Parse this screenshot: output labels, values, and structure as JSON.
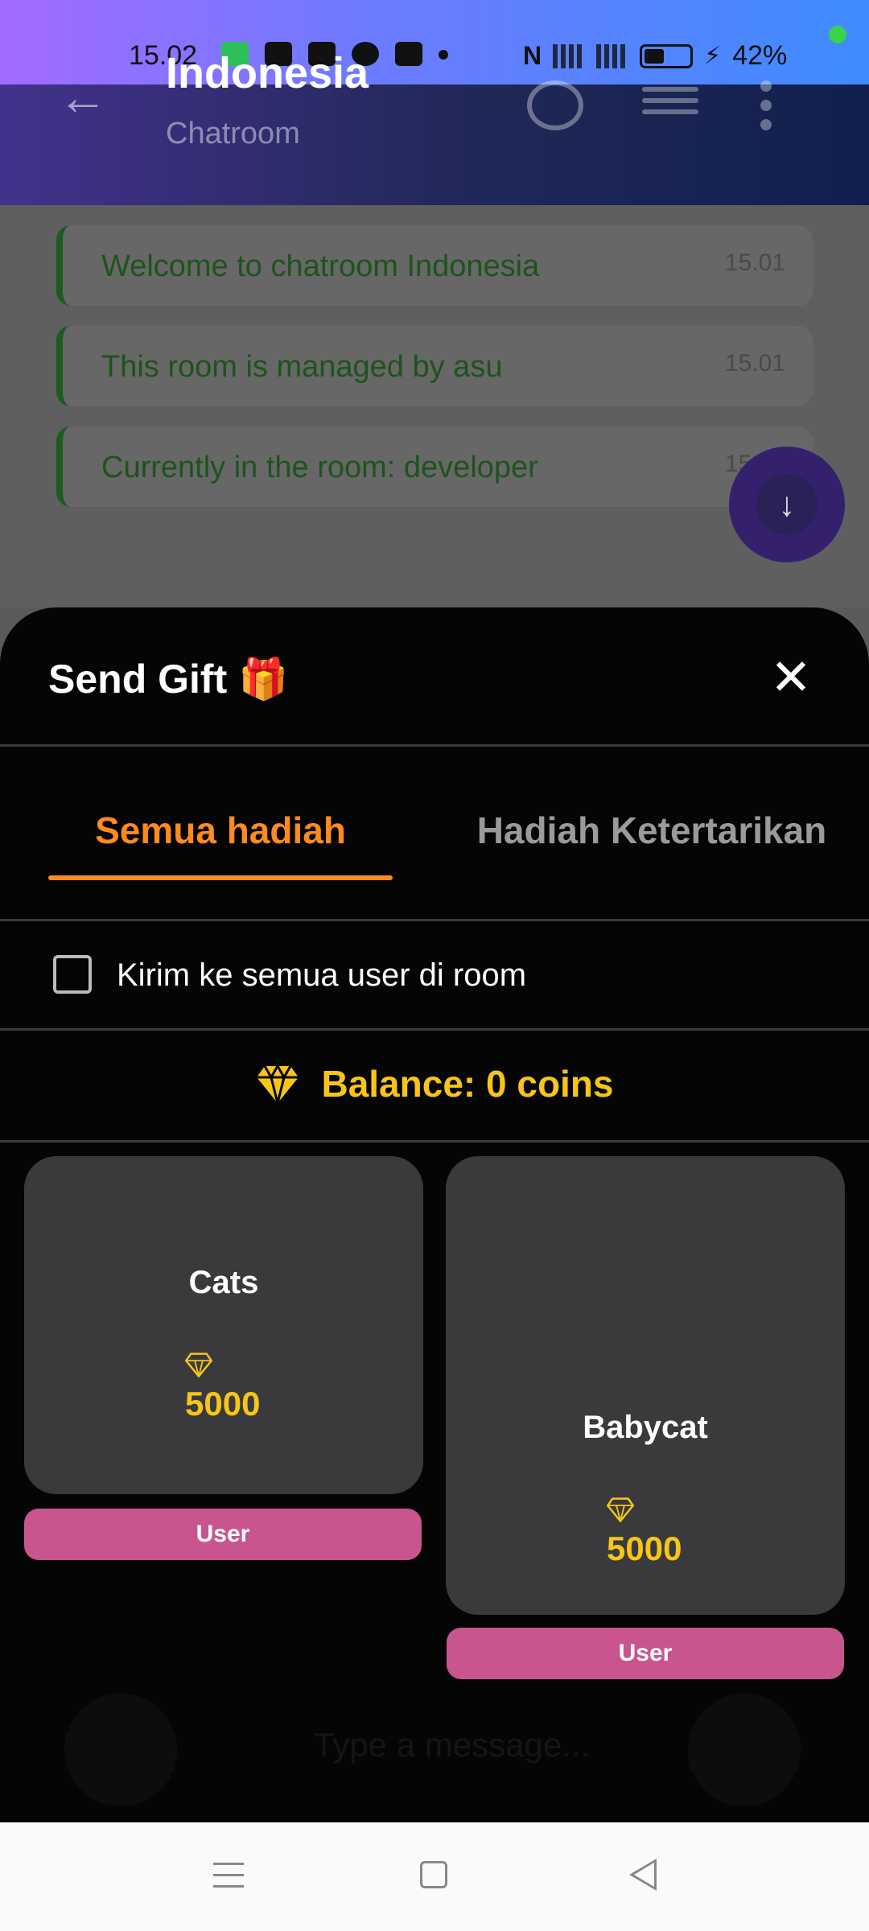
{
  "status_bar": {
    "time": "15.02",
    "battery": "42%"
  },
  "header": {
    "title": "Indonesia",
    "subtitle": "Chatroom"
  },
  "messages": [
    {
      "text": "Welcome to chatroom Indonesia",
      "time": "15.01"
    },
    {
      "text": "This room is managed by asu",
      "time": "15.01"
    },
    {
      "text": "Currently in the room: developer",
      "time": "15.01"
    }
  ],
  "sheet": {
    "title": "Send Gift 🎁",
    "tabs": [
      {
        "label": "Semua hadiah",
        "active": true
      },
      {
        "label": "Hadiah Ketertarikan",
        "active": false
      }
    ],
    "send_all_label": "Kirim ke semua user di room",
    "balance": "Balance: 0 coins",
    "gifts": [
      {
        "name": "Cats",
        "price": "5000",
        "button": "User"
      },
      {
        "name": "Babycat",
        "price": "5000",
        "button": "User"
      }
    ]
  },
  "input_placeholder": "Type a message...",
  "colors": {
    "accent": "#ff8a1d",
    "gold": "#f7c518",
    "user_button": "#c9558f",
    "card": "#3a3a3d"
  },
  "icons": [
    "back-arrow-icon",
    "chat-bubble-icon",
    "list-icon",
    "more-vert-icon",
    "close-icon",
    "diamond-icon",
    "scroll-down-icon"
  ]
}
